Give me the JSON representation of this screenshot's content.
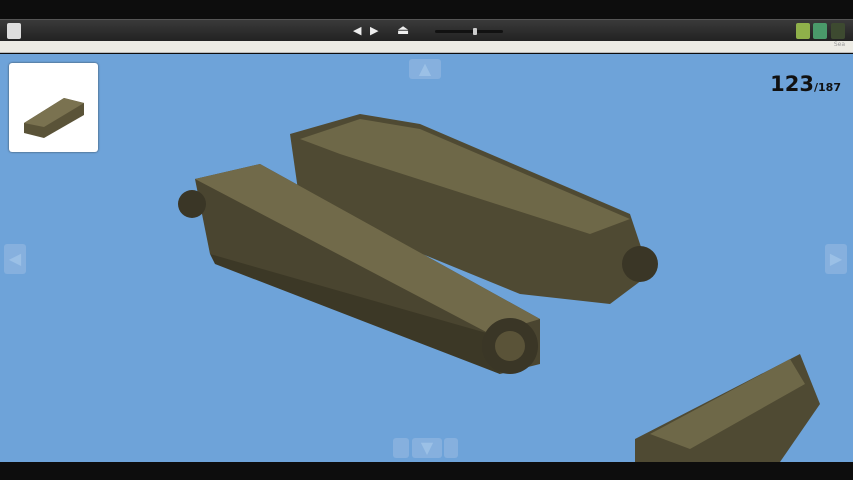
{
  "toolbar": {
    "prev": "◀",
    "next": "▶",
    "export": "⏏",
    "slider_value": 0.6,
    "strip_text": "Sea"
  },
  "step": {
    "current": "123",
    "total": "/187"
  },
  "nav": {
    "up": "▲",
    "down": "▼",
    "left": "◀",
    "right": "▶"
  },
  "colors": {
    "background": "#6ea3d9",
    "brick": "#5a5338"
  }
}
